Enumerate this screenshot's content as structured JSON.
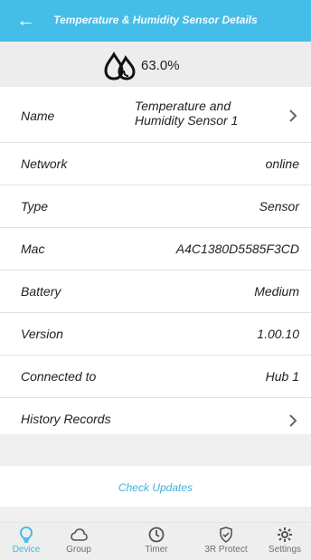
{
  "header": {
    "title": "Temperature & Humidity Sensor Details",
    "back_icon": "arrow-left-icon"
  },
  "humidity": {
    "icon": "water-drops-icon",
    "value": "63.0%"
  },
  "details": [
    {
      "key": "name",
      "label": "Name",
      "value": "Temperature and\nHumidity Sensor 1",
      "navigable": true
    },
    {
      "key": "network",
      "label": "Network",
      "value": "online",
      "navigable": false
    },
    {
      "key": "type",
      "label": "Type",
      "value": "Sensor",
      "navigable": false
    },
    {
      "key": "mac",
      "label": "Mac",
      "value": "A4C1380D5585F3CD",
      "navigable": false
    },
    {
      "key": "battery",
      "label": "Battery",
      "value": "Medium",
      "navigable": false
    },
    {
      "key": "version",
      "label": "Version",
      "value": "1.00.10",
      "navigable": false
    },
    {
      "key": "connected",
      "label": "Connected to",
      "value": "Hub 1",
      "navigable": false
    },
    {
      "key": "history",
      "label": "History Records",
      "value": "",
      "navigable": true
    }
  ],
  "actions": {
    "check_updates": "Check Updates"
  },
  "bottom_nav": [
    {
      "label": "Device",
      "icon": "lightbulb-icon",
      "active": true
    },
    {
      "label": "Group",
      "icon": "cloud-icon",
      "active": false
    },
    {
      "label": "Timer",
      "icon": "clock-icon",
      "active": false
    },
    {
      "label": "3R Protect",
      "icon": "shield-check-icon",
      "active": false
    },
    {
      "label": "Settings",
      "icon": "gear-icon",
      "active": false
    }
  ],
  "colors": {
    "header": "#45bde9",
    "accent": "#3eb0dc",
    "band": "#ededed"
  }
}
